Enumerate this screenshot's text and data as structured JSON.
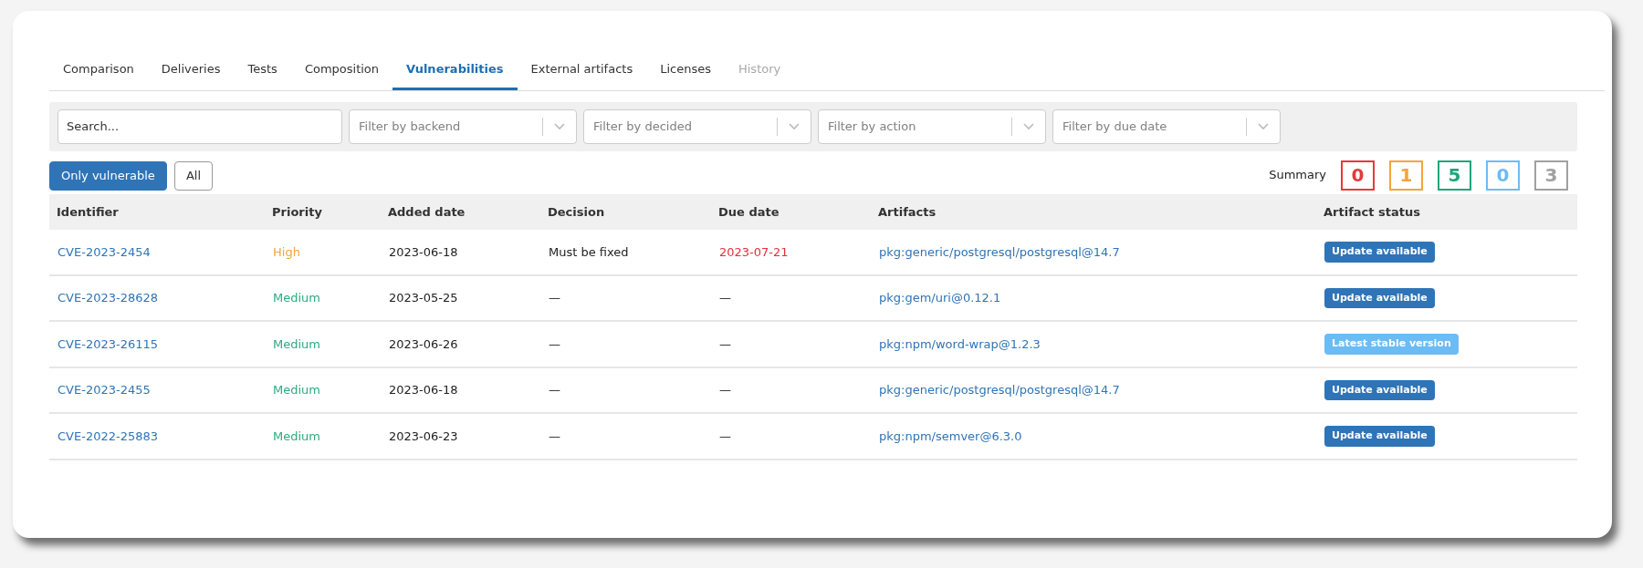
{
  "tabs": [
    {
      "label": "Comparison",
      "selected": false,
      "disabled": false
    },
    {
      "label": "Deliveries",
      "selected": false,
      "disabled": false
    },
    {
      "label": "Tests",
      "selected": false,
      "disabled": false
    },
    {
      "label": "Composition",
      "selected": false,
      "disabled": false
    },
    {
      "label": "Vulnerabilities",
      "selected": true,
      "disabled": false
    },
    {
      "label": "External artifacts",
      "selected": false,
      "disabled": false
    },
    {
      "label": "Licenses",
      "selected": false,
      "disabled": false
    },
    {
      "label": "History",
      "selected": false,
      "disabled": true
    }
  ],
  "search": {
    "placeholder": "Search..."
  },
  "filters": [
    {
      "placeholder": "Filter by backend"
    },
    {
      "placeholder": "Filter by decided"
    },
    {
      "placeholder": "Filter by action"
    },
    {
      "placeholder": "Filter by due date"
    }
  ],
  "toggle_buttons": [
    {
      "label": "Only vulnerable",
      "selected": true
    },
    {
      "label": "All",
      "selected": false
    }
  ],
  "summary": {
    "label": "Summary",
    "counts": [
      {
        "value": "0",
        "color": "#e8383d"
      },
      {
        "value": "1",
        "color": "#f5a43c"
      },
      {
        "value": "5",
        "color": "#1fa67a"
      },
      {
        "value": "0",
        "color": "#6bbcf5"
      },
      {
        "value": "3",
        "color": "#a0a0a0"
      }
    ]
  },
  "table": {
    "columns": [
      "Identifier",
      "Priority",
      "Added date",
      "Decision",
      "Due date",
      "Artifacts",
      "Artifact status"
    ],
    "rows": [
      {
        "identifier": "CVE-2023-2454",
        "priority": {
          "text": "High",
          "color": "#f5a43c"
        },
        "added_date": "2023-06-18",
        "decision": "Must be fixed",
        "due_date": "2023-07-21",
        "overdue": true,
        "artifact": "pkg:generic/postgresql/postgresql@14.7",
        "status": {
          "text": "Update available",
          "kind": "update"
        }
      },
      {
        "identifier": "CVE-2023-28628",
        "priority": {
          "text": "Medium",
          "color": "#2eaa7e"
        },
        "added_date": "2023-05-25",
        "decision": "—",
        "due_date": "—",
        "overdue": false,
        "artifact": "pkg:gem/uri@0.12.1",
        "status": {
          "text": "Update available",
          "kind": "update"
        }
      },
      {
        "identifier": "CVE-2023-26115",
        "priority": {
          "text": "Medium",
          "color": "#2eaa7e"
        },
        "added_date": "2023-06-26",
        "decision": "—",
        "due_date": "—",
        "overdue": false,
        "artifact": "pkg:npm/word-wrap@1.2.3",
        "status": {
          "text": "Latest stable version",
          "kind": "latest"
        }
      },
      {
        "identifier": "CVE-2023-2455",
        "priority": {
          "text": "Medium",
          "color": "#2eaa7e"
        },
        "added_date": "2023-06-18",
        "decision": "—",
        "due_date": "—",
        "overdue": false,
        "artifact": "pkg:generic/postgresql/postgresql@14.7",
        "status": {
          "text": "Update available",
          "kind": "update"
        }
      },
      {
        "identifier": "CVE-2022-25883",
        "priority": {
          "text": "Medium",
          "color": "#2eaa7e"
        },
        "added_date": "2023-06-23",
        "decision": "—",
        "due_date": "—",
        "overdue": false,
        "artifact": "pkg:npm/semver@6.3.0",
        "status": {
          "text": "Update available",
          "kind": "update"
        }
      }
    ]
  }
}
